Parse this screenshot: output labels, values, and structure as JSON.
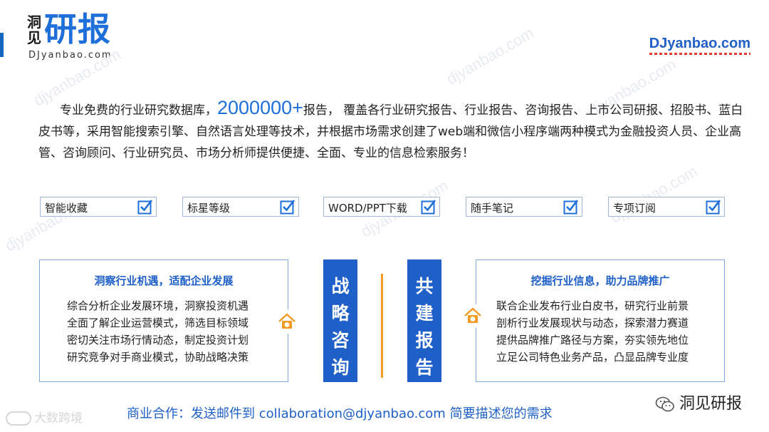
{
  "logo": {
    "small_chars": "洞见",
    "big_chars": "研报",
    "domain": "DJyanbao.com"
  },
  "header": {
    "right_domain": "DJyanbao.com"
  },
  "watermark_text": "djyanbao.com",
  "intro": {
    "part1": "专业免费的行业研究数据库，",
    "highlight": "2000000+",
    "part2": "报告， 覆盖各行业研究报告、行业报告、咨询报告、上市公司研报、招股书、蓝白皮书等，采用智能搜索引擎、自然语言处理等技术，并根据市场需求创建了web端和微信小程序端两种模式为金融投资人员、企业高管、咨询顾问、行业研究员、市场分析师提供便捷、全面、专业的信息检索服务！"
  },
  "features": [
    {
      "label": "智能收藏"
    },
    {
      "label": "标星等级"
    },
    {
      "label": "WORD/PPT下载"
    },
    {
      "label": "随手笔记"
    },
    {
      "label": "专项订阅"
    }
  ],
  "left_panel": {
    "title": "洞察行业机遇，适配企业发展",
    "lines": [
      "综合分析企业发展环境，洞察投资机遇",
      "全面了解企业运营模式，筛选目标领域",
      "密切关注市场行情动态，制定投资计划",
      "研究竞争对手商业模式，协助战略决策"
    ]
  },
  "right_panel": {
    "title": "挖掘行业信息，助力品牌推广",
    "lines": [
      "联合企业发布行业白皮书，研究行业前景",
      "剖析行业发展现状与动态，探索潜力赛道",
      "提供品牌推广路径与方案，夯实领先地位",
      "立足公司特色业务产品，凸显品牌专业度"
    ]
  },
  "center_boxes": {
    "left": [
      "战",
      "略",
      "咨",
      "询"
    ],
    "right": [
      "共",
      "建",
      "报",
      "告"
    ]
  },
  "contact": {
    "text": "商业合作：发送邮件到 collaboration@djyanbao.com 简要描述您的需求"
  },
  "bottom_left_brand": "大数跨境",
  "bottom_right_brand": "洞见研报",
  "colors": {
    "brand_blue": "#1e6fd9",
    "panel_border": "#7ea6e0",
    "accent_orange": "#f59b23"
  }
}
